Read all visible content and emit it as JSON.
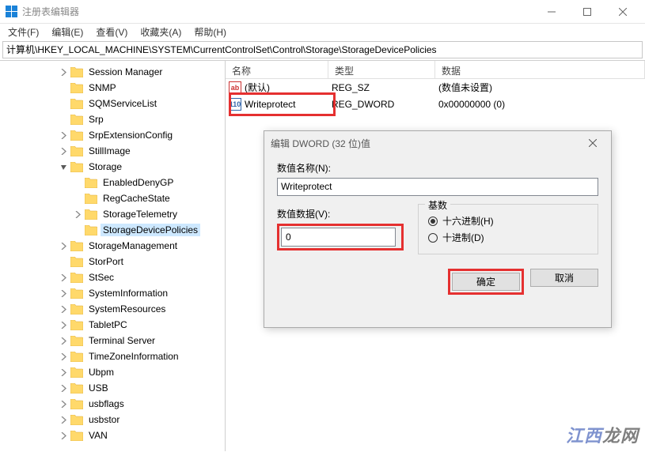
{
  "window": {
    "title": "注册表编辑器"
  },
  "menu": {
    "file": "文件(F)",
    "edit": "编辑(E)",
    "view": "查看(V)",
    "fav": "收藏夹(A)",
    "help": "帮助(H)"
  },
  "address": "计算机\\HKEY_LOCAL_MACHINE\\SYSTEM\\CurrentControlSet\\Control\\Storage\\StorageDevicePolicies",
  "tree": [
    {
      "indent": 3,
      "chev": ">",
      "label": "Session Manager"
    },
    {
      "indent": 3,
      "chev": "",
      "label": "SNMP"
    },
    {
      "indent": 3,
      "chev": "",
      "label": "SQMServiceList"
    },
    {
      "indent": 3,
      "chev": "",
      "label": "Srp"
    },
    {
      "indent": 3,
      "chev": ">",
      "label": "SrpExtensionConfig"
    },
    {
      "indent": 3,
      "chev": ">",
      "label": "StillImage"
    },
    {
      "indent": 3,
      "chev": "v",
      "label": "Storage"
    },
    {
      "indent": 4,
      "chev": "",
      "label": "EnabledDenyGP"
    },
    {
      "indent": 4,
      "chev": "",
      "label": "RegCacheState"
    },
    {
      "indent": 4,
      "chev": ">",
      "label": "StorageTelemetry"
    },
    {
      "indent": 4,
      "chev": "",
      "label": "StorageDevicePolicies",
      "selected": true
    },
    {
      "indent": 3,
      "chev": ">",
      "label": "StorageManagement"
    },
    {
      "indent": 3,
      "chev": "",
      "label": "StorPort"
    },
    {
      "indent": 3,
      "chev": ">",
      "label": "StSec"
    },
    {
      "indent": 3,
      "chev": ">",
      "label": "SystemInformation"
    },
    {
      "indent": 3,
      "chev": ">",
      "label": "SystemResources"
    },
    {
      "indent": 3,
      "chev": ">",
      "label": "TabletPC"
    },
    {
      "indent": 3,
      "chev": ">",
      "label": "Terminal Server"
    },
    {
      "indent": 3,
      "chev": ">",
      "label": "TimeZoneInformation"
    },
    {
      "indent": 3,
      "chev": ">",
      "label": "Ubpm"
    },
    {
      "indent": 3,
      "chev": ">",
      "label": "USB"
    },
    {
      "indent": 3,
      "chev": ">",
      "label": "usbflags"
    },
    {
      "indent": 3,
      "chev": ">",
      "label": "usbstor"
    },
    {
      "indent": 3,
      "chev": ">",
      "label": "VAN"
    }
  ],
  "list": {
    "cols": {
      "name": "名称",
      "type": "类型",
      "data": "数据"
    },
    "rows": [
      {
        "icon": "sz",
        "name": "(默认)",
        "type": "REG_SZ",
        "data": "(数值未设置)"
      },
      {
        "icon": "dw",
        "name": "Writeprotect",
        "type": "REG_DWORD",
        "data": "0x00000000 (0)"
      }
    ]
  },
  "dialog": {
    "title": "编辑 DWORD (32 位)值",
    "name_label": "数值名称(N):",
    "name_value": "Writeprotect",
    "data_label": "数值数据(V):",
    "data_value": "0",
    "base_label": "基数",
    "hex": "十六进制(H)",
    "dec": "十进制(D)",
    "ok": "确定",
    "cancel": "取消"
  },
  "watermark": {
    "a": "江西",
    "b": "龙网"
  }
}
